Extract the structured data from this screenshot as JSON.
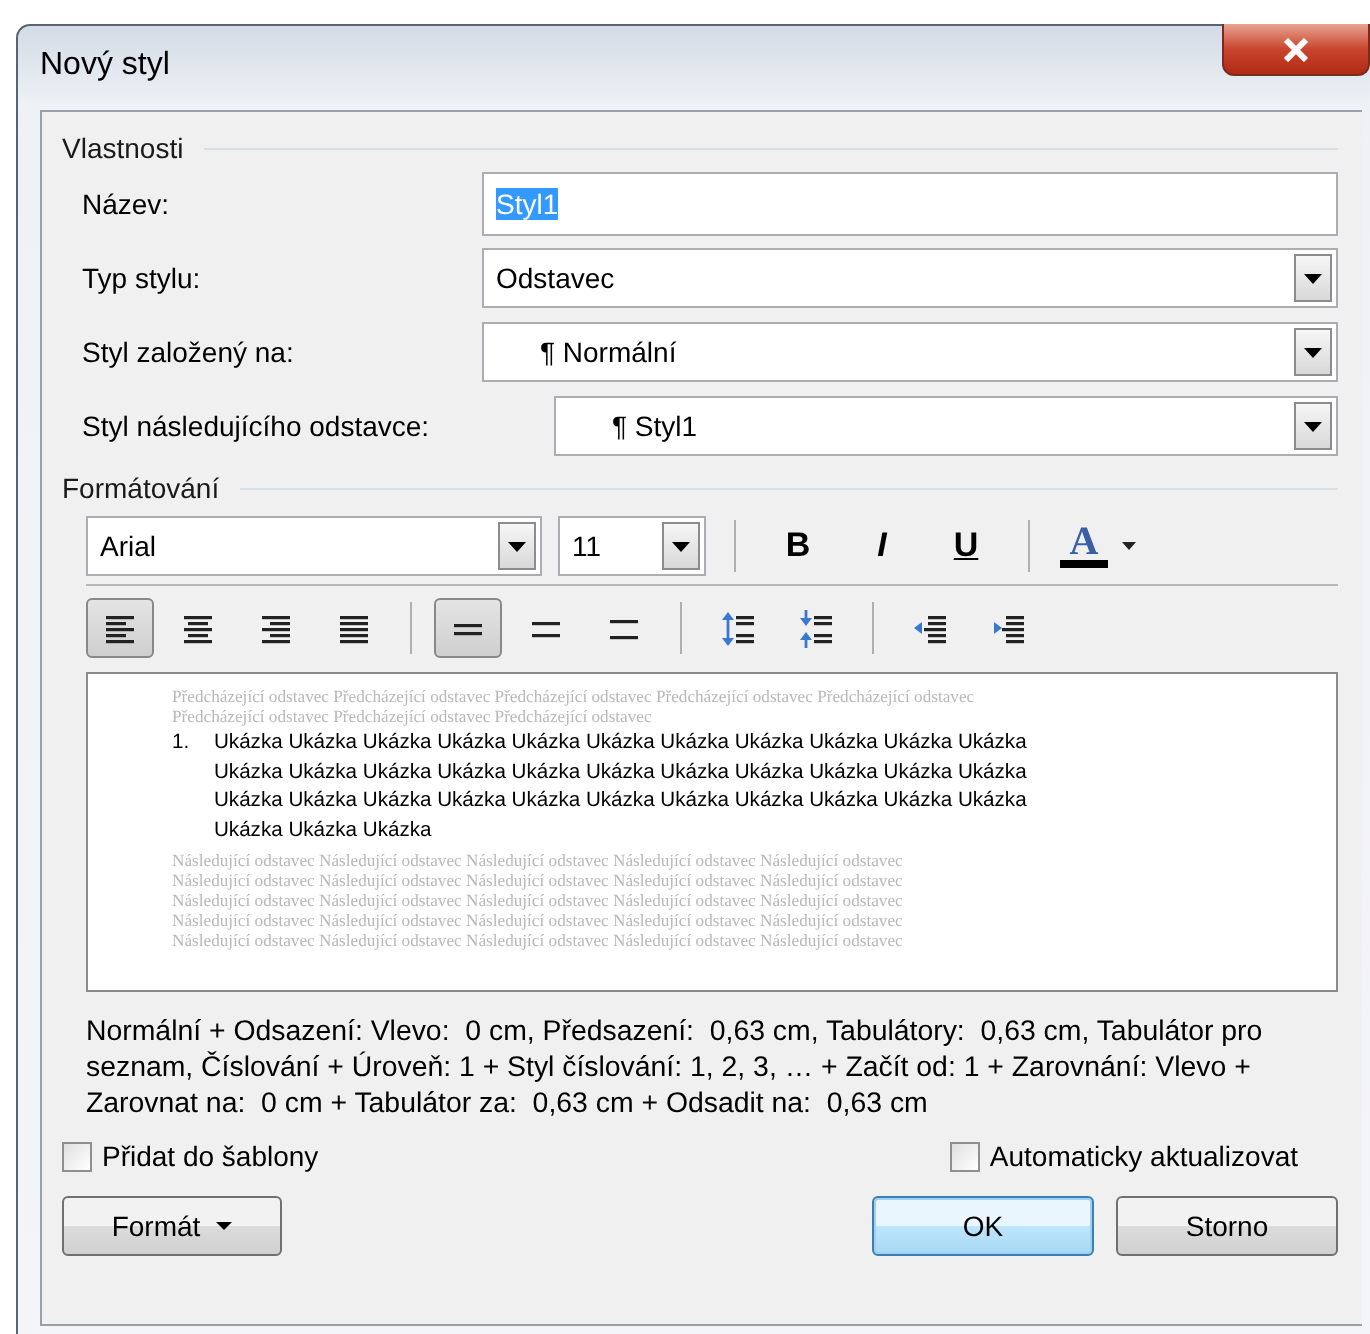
{
  "window": {
    "title": "Nový styl"
  },
  "properties": {
    "legend": "Vlastnosti",
    "fields": [
      {
        "label": "Název:",
        "kind": "text",
        "value": "Styl1",
        "highlighted": true
      },
      {
        "label": "Typ stylu:",
        "kind": "dropdown",
        "value": "Odstavec",
        "highlighted": false
      },
      {
        "label": "Styl založený na:",
        "kind": "style-dropdown",
        "value": "¶ Normální",
        "highlighted": false
      },
      {
        "label": "Styl následujícího odstavce:",
        "kind": "style-dropdown",
        "value": "¶ Styl1",
        "highlighted": false
      }
    ]
  },
  "formatting": {
    "legend": "Formátování",
    "font": "Arial",
    "size": "11",
    "text_buttons": [
      {
        "kind": "bold",
        "label": "B"
      },
      {
        "kind": "italic",
        "label": "I"
      },
      {
        "kind": "underline",
        "label": "U"
      }
    ],
    "font_color": {
      "label": "A",
      "color": "#000000"
    },
    "paragraph_buttons": [
      {
        "kind": "align-left",
        "selected": true
      },
      {
        "kind": "align-center",
        "selected": false
      },
      {
        "kind": "align-right",
        "selected": false
      },
      {
        "kind": "justify",
        "selected": false
      },
      {
        "kind": "single-spacing",
        "selected": true
      },
      {
        "kind": "one-half-spacing",
        "selected": false
      },
      {
        "kind": "double-spacing",
        "selected": false
      },
      {
        "kind": "space-increase",
        "selected": false
      },
      {
        "kind": "space-decrease",
        "selected": false
      },
      {
        "kind": "indent-decrease",
        "selected": false
      },
      {
        "kind": "indent-increase",
        "selected": false
      }
    ]
  },
  "preview": {
    "previous_lines": [
      "Předcházející odstavec Předcházející odstavec Předcházející odstavec Předcházející odstavec Předcházející odstavec",
      "Předcházející odstavec Předcházející odstavec Předcházející odstavec"
    ],
    "sample_number": "1.",
    "sample_lines": [
      "Ukázka Ukázka Ukázka Ukázka Ukázka Ukázka Ukázka Ukázka Ukázka Ukázka Ukázka",
      "Ukázka Ukázka Ukázka Ukázka Ukázka Ukázka Ukázka Ukázka Ukázka Ukázka Ukázka",
      "Ukázka Ukázka Ukázka Ukázka Ukázka Ukázka Ukázka Ukázka Ukázka Ukázka Ukázka",
      "Ukázka Ukázka Ukázka"
    ],
    "following_lines": [
      "Následující odstavec Následující odstavec Následující odstavec Následující odstavec Následující odstavec",
      "Následující odstavec Následující odstavec Následující odstavec Následující odstavec Následující odstavec",
      "Následující odstavec Následující odstavec Následující odstavec Následující odstavec Následující odstavec",
      "Následující odstavec Následující odstavec Následující odstavec Následující odstavec Následující odstavec",
      "Následující odstavec Následující odstavec Následující odstavec Následující odstavec Následující odstavec"
    ]
  },
  "description": "Normální + Odsazení: Vlevo:  0 cm, Předsazení:  0,63 cm, Tabulátory:  0,63 cm, Tabulátor pro seznam, Číslování + Úroveň: 1 + Styl číslování: 1, 2, 3, … + Začít od: 1 + Zarovnání: Vlevo + Zarovnat na:  0 cm + Tabulátor za:  0,63 cm + Odsadit na:  0,63 cm",
  "checkboxes": [
    {
      "label": "Přidat do šablony",
      "checked": false
    },
    {
      "label": "Automaticky aktualizovat",
      "checked": false
    }
  ],
  "buttons": [
    {
      "label": "Formát",
      "kind": "menu",
      "default": false
    },
    {
      "label": "OK",
      "kind": "plain",
      "default": true
    },
    {
      "label": "Storno",
      "kind": "plain",
      "default": false
    }
  ]
}
